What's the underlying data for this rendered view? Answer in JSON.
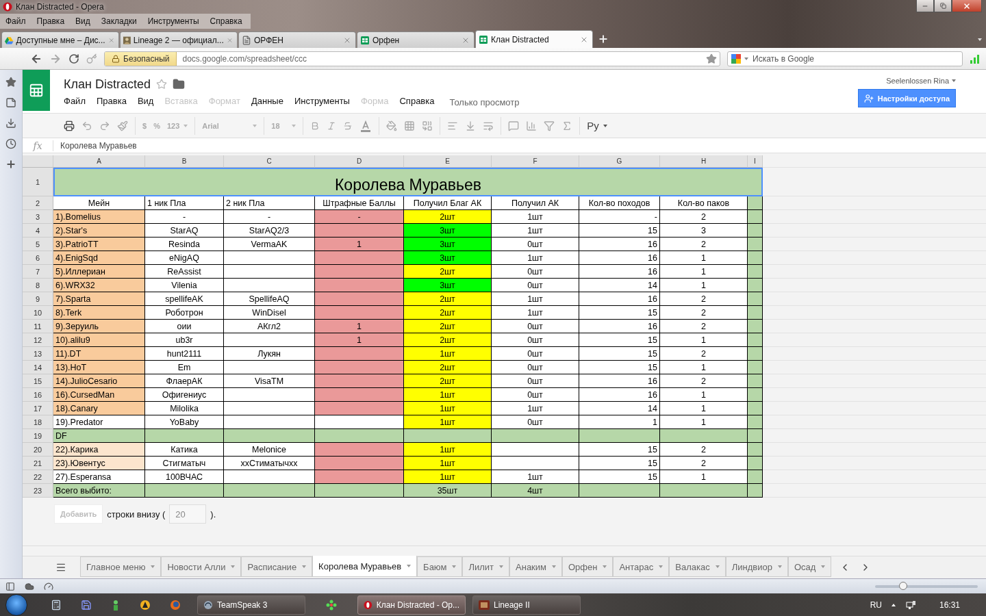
{
  "window": {
    "title": "Клан Distracted - Opera"
  },
  "menu": [
    "Файл",
    "Правка",
    "Вид",
    "Закладки",
    "Инструменты",
    "Справка"
  ],
  "tabs": [
    {
      "title": "Доступные мне – Дис...",
      "selected": false
    },
    {
      "title": "Lineage 2 — официал...",
      "selected": false
    },
    {
      "title": "ОРФЕН",
      "selected": false
    },
    {
      "title": "Орфен",
      "selected": false
    },
    {
      "title": "Клан Distracted",
      "selected": true
    }
  ],
  "address_bar": {
    "security": "Безопасный",
    "url": "docs.google.com/spreadsheet/ccc"
  },
  "search": {
    "placeholder": "Искать в Google"
  },
  "document": {
    "title": "Клан Distracted",
    "starred": false,
    "view_mode": "Только просмотр",
    "account": "Seelenlossen Rina",
    "share_button": "Настройки доступа",
    "menu": [
      {
        "label": "Файл",
        "disabled": false
      },
      {
        "label": "Правка",
        "disabled": false
      },
      {
        "label": "Вид",
        "disabled": false
      },
      {
        "label": "Вставка",
        "disabled": true
      },
      {
        "label": "Формат",
        "disabled": true
      },
      {
        "label": "Данные",
        "disabled": false
      },
      {
        "label": "Инструменты",
        "disabled": false
      },
      {
        "label": "Форма",
        "disabled": true
      },
      {
        "label": "Справка",
        "disabled": false
      }
    ]
  },
  "toolbar": {
    "currency": "$",
    "percent": "%",
    "number_format": "123",
    "font": "Arial",
    "font_size": "18",
    "input_tools": "Ру"
  },
  "formula_bar": {
    "label": "fx",
    "value": "Королева Муравьев"
  },
  "sheet": {
    "columns": [
      "A",
      "B",
      "C",
      "D",
      "E",
      "F",
      "G",
      "H",
      "I"
    ],
    "title_row": {
      "number": "1",
      "text": "Королева Муравьев",
      "color": "#b6d7a8"
    },
    "rows": [
      {
        "number": "2",
        "kind": "header",
        "cells": [
          {
            "text": "Мейн"
          },
          {
            "text": "1 ник Пла"
          },
          {
            "text": "2 ник Пла"
          },
          {
            "text": "Штрафные Баллы"
          },
          {
            "text": "Получил Благ АК"
          },
          {
            "text": "Получил АК"
          },
          {
            "text": "Кол-во походов"
          },
          {
            "text": "Кол-во паков"
          },
          {
            "color": "#b6d7a8"
          }
        ]
      },
      {
        "number": "3",
        "kind": "data",
        "cells": [
          {
            "text": "1).Bomelius",
            "color": "#f9cb9c"
          },
          {
            "text": "-"
          },
          {
            "text": "-"
          },
          {
            "text": "-",
            "color": "#ea9999"
          },
          {
            "text": "2шт",
            "color": "#ffff00"
          },
          {
            "text": "1шт"
          },
          {
            "text": "-"
          },
          {
            "text": "2"
          },
          {
            "color": "#b6d7a8"
          }
        ]
      },
      {
        "number": "4",
        "kind": "data",
        "cells": [
          {
            "text": "2).Star's",
            "color": "#f9cb9c"
          },
          {
            "text": "StarAQ"
          },
          {
            "text": "StarAQ2/3"
          },
          {
            "color": "#ea9999"
          },
          {
            "text": "3шт",
            "color": "#00ff00"
          },
          {
            "text": "1шт"
          },
          {
            "text": "15"
          },
          {
            "text": "3"
          },
          {
            "color": "#b6d7a8"
          }
        ]
      },
      {
        "number": "5",
        "kind": "data",
        "cells": [
          {
            "text": "3).PatrioTT",
            "color": "#f9cb9c"
          },
          {
            "text": "Resinda"
          },
          {
            "text": "VermaAK"
          },
          {
            "text": "1",
            "color": "#ea9999"
          },
          {
            "text": "3шт",
            "color": "#00ff00"
          },
          {
            "text": "0шт"
          },
          {
            "text": "16"
          },
          {
            "text": "2"
          },
          {
            "color": "#b6d7a8"
          }
        ]
      },
      {
        "number": "6",
        "kind": "data",
        "cells": [
          {
            "text": "4).EnigSqd",
            "color": "#f9cb9c"
          },
          {
            "text": "eNigAQ"
          },
          {},
          {
            "color": "#ea9999"
          },
          {
            "text": "3шт",
            "color": "#00ff00"
          },
          {
            "text": "1шт"
          },
          {
            "text": "16"
          },
          {
            "text": "1"
          },
          {
            "color": "#b6d7a8"
          }
        ]
      },
      {
        "number": "7",
        "kind": "data",
        "cells": [
          {
            "text": "5).Иллериан",
            "color": "#f9cb9c"
          },
          {
            "text": "ReAssist"
          },
          {},
          {
            "color": "#ea9999"
          },
          {
            "text": "2шт",
            "color": "#ffff00"
          },
          {
            "text": "0шт"
          },
          {
            "text": "16"
          },
          {
            "text": "1"
          },
          {
            "color": "#b6d7a8"
          }
        ]
      },
      {
        "number": "8",
        "kind": "data",
        "cells": [
          {
            "text": "6).WRX32",
            "color": "#f9cb9c"
          },
          {
            "text": "Vilenia"
          },
          {},
          {
            "color": "#ea9999"
          },
          {
            "text": "3шт",
            "color": "#00ff00"
          },
          {
            "text": "0шт"
          },
          {
            "text": "14"
          },
          {
            "text": "1"
          },
          {
            "color": "#b6d7a8"
          }
        ]
      },
      {
        "number": "9",
        "kind": "data",
        "cells": [
          {
            "text": "7).Sparta",
            "color": "#f9cb9c"
          },
          {
            "text": "spellifeAK"
          },
          {
            "text": "SpellifeAQ"
          },
          {
            "color": "#ea9999"
          },
          {
            "text": "2шт",
            "color": "#ffff00"
          },
          {
            "text": "1шт"
          },
          {
            "text": "16"
          },
          {
            "text": "2"
          },
          {
            "color": "#b6d7a8"
          }
        ]
      },
      {
        "number": "10",
        "kind": "data",
        "cells": [
          {
            "text": "8).Terk",
            "color": "#f9cb9c"
          },
          {
            "text": "Роботрон"
          },
          {
            "text": "WinDisel"
          },
          {
            "color": "#ea9999"
          },
          {
            "text": "2шт",
            "color": "#ffff00"
          },
          {
            "text": "1шт"
          },
          {
            "text": "15"
          },
          {
            "text": "2"
          },
          {
            "color": "#b6d7a8"
          }
        ]
      },
      {
        "number": "11",
        "kind": "data",
        "cells": [
          {
            "text": "9).Зеруиль",
            "color": "#f9cb9c"
          },
          {
            "text": "оии"
          },
          {
            "text": "АКгл2"
          },
          {
            "text": "1",
            "color": "#ea9999"
          },
          {
            "text": "2шт",
            "color": "#ffff00"
          },
          {
            "text": "0шт"
          },
          {
            "text": "16"
          },
          {
            "text": "2"
          },
          {
            "color": "#b6d7a8"
          }
        ]
      },
      {
        "number": "12",
        "kind": "data",
        "cells": [
          {
            "text": "10).alilu9",
            "color": "#f9cb9c"
          },
          {
            "text": "ub3r"
          },
          {},
          {
            "text": "1",
            "color": "#ea9999"
          },
          {
            "text": "2шт",
            "color": "#ffff00"
          },
          {
            "text": "0шт"
          },
          {
            "text": "15"
          },
          {
            "text": "1"
          },
          {
            "color": "#b6d7a8"
          }
        ]
      },
      {
        "number": "13",
        "kind": "data",
        "cells": [
          {
            "text": "11).DT",
            "color": "#f9cb9c"
          },
          {
            "text": "hunt2111"
          },
          {
            "text": "Лукян"
          },
          {
            "color": "#ea9999"
          },
          {
            "text": "1шт",
            "color": "#ffff00"
          },
          {
            "text": "0шт"
          },
          {
            "text": "15"
          },
          {
            "text": "2"
          },
          {
            "color": "#b6d7a8"
          }
        ]
      },
      {
        "number": "14",
        "kind": "data",
        "cells": [
          {
            "text": "13).HoT",
            "color": "#f9cb9c"
          },
          {
            "text": "Em"
          },
          {},
          {
            "color": "#ea9999"
          },
          {
            "text": "2шт",
            "color": "#ffff00"
          },
          {
            "text": "0шт"
          },
          {
            "text": "15"
          },
          {
            "text": "1"
          },
          {
            "color": "#b6d7a8"
          }
        ]
      },
      {
        "number": "15",
        "kind": "data",
        "cells": [
          {
            "text": "14).JulioCesario",
            "color": "#f9cb9c"
          },
          {
            "text": "ФлаерАК"
          },
          {
            "text": "VisaTM"
          },
          {
            "color": "#ea9999"
          },
          {
            "text": "2шт",
            "color": "#ffff00"
          },
          {
            "text": "0шт"
          },
          {
            "text": "16"
          },
          {
            "text": "2"
          },
          {
            "color": "#b6d7a8"
          }
        ]
      },
      {
        "number": "16",
        "kind": "data",
        "cells": [
          {
            "text": "16).CursedMan",
            "color": "#f9cb9c"
          },
          {
            "text": "Офигениус"
          },
          {},
          {
            "color": "#ea9999"
          },
          {
            "text": "1шт",
            "color": "#ffff00"
          },
          {
            "text": "0шт"
          },
          {
            "text": "16"
          },
          {
            "text": "1"
          },
          {
            "color": "#b6d7a8"
          }
        ]
      },
      {
        "number": "17",
        "kind": "data",
        "cells": [
          {
            "text": "18).Canary",
            "color": "#f9cb9c"
          },
          {
            "text": "Milolika"
          },
          {},
          {
            "color": "#ea9999"
          },
          {
            "text": "1шт",
            "color": "#ffff00"
          },
          {
            "text": "1шт"
          },
          {
            "text": "14"
          },
          {
            "text": "1"
          },
          {
            "color": "#b6d7a8"
          }
        ]
      },
      {
        "number": "18",
        "kind": "data",
        "cells": [
          {
            "text": "19).Predator"
          },
          {
            "text": "YoBaby"
          },
          {},
          {},
          {
            "text": "1шт",
            "color": "#ffff00"
          },
          {
            "text": "0шт"
          },
          {
            "text": "1"
          },
          {
            "text": "1"
          },
          {
            "color": "#b6d7a8"
          }
        ]
      },
      {
        "number": "19",
        "kind": "data",
        "cells": [
          {
            "text": "DF",
            "color": "#b6d7a8"
          },
          {
            "color": "#b6d7a8"
          },
          {
            "color": "#b6d7a8"
          },
          {
            "color": "#b6d7a8"
          },
          {
            "color": "#b6d7a8"
          },
          {
            "color": "#b6d7a8"
          },
          {
            "color": "#b6d7a8"
          },
          {
            "color": "#b6d7a8"
          },
          {
            "color": "#b6d7a8"
          }
        ]
      },
      {
        "number": "20",
        "kind": "data",
        "cells": [
          {
            "text": "22).Карика",
            "color": "#fce5cd"
          },
          {
            "text": "Катика"
          },
          {
            "text": "Melonice"
          },
          {
            "color": "#ea9999"
          },
          {
            "text": "1шт",
            "color": "#ffff00"
          },
          {},
          {
            "text": "15"
          },
          {
            "text": "2"
          },
          {
            "color": "#b6d7a8"
          }
        ]
      },
      {
        "number": "21",
        "kind": "data",
        "cells": [
          {
            "text": "23).Ювентус",
            "color": "#fce5cd"
          },
          {
            "text": "Стигматыч"
          },
          {
            "text": "ххСтиматычхх"
          },
          {
            "color": "#ea9999"
          },
          {
            "text": "1шт",
            "color": "#ffff00"
          },
          {},
          {
            "text": "15"
          },
          {
            "text": "2"
          },
          {
            "color": "#b6d7a8"
          }
        ]
      },
      {
        "number": "22",
        "kind": "data",
        "cells": [
          {
            "text": "27).Esperansa"
          },
          {
            "text": "100ВЧАС"
          },
          {},
          {
            "color": "#ea9999"
          },
          {
            "text": "1шт",
            "color": "#ffff00"
          },
          {
            "text": "1шт"
          },
          {
            "text": "15"
          },
          {
            "text": "1"
          },
          {
            "color": "#b6d7a8"
          }
        ]
      },
      {
        "number": "23",
        "kind": "data",
        "cells": [
          {
            "text": "Всего выбито:",
            "color": "#b6d7a8"
          },
          {
            "color": "#b6d7a8"
          },
          {
            "color": "#b6d7a8"
          },
          {
            "color": "#b6d7a8"
          },
          {
            "text": "35шт",
            "color": "#b6d7a8"
          },
          {
            "text": "4шт",
            "color": "#b6d7a8"
          },
          {
            "color": "#b6d7a8"
          },
          {
            "color": "#b6d7a8"
          },
          {
            "color": "#b6d7a8"
          }
        ]
      }
    ]
  },
  "add_rows": {
    "button": "Добавить",
    "label": "строки внизу (",
    "value": "20",
    "suffix": ")."
  },
  "sheet_tabs": [
    {
      "label": "Главное меню",
      "selected": false
    },
    {
      "label": "Новости Алли",
      "selected": false
    },
    {
      "label": "Расписание",
      "selected": false
    },
    {
      "label": "Королева Муравьев",
      "selected": true
    },
    {
      "label": "Баюм",
      "selected": false
    },
    {
      "label": "Лилит",
      "selected": false
    },
    {
      "label": "Анаким",
      "selected": false
    },
    {
      "label": "Орфен",
      "selected": false
    },
    {
      "label": "Антарас",
      "selected": false
    },
    {
      "label": "Валакас",
      "selected": false
    },
    {
      "label": "Линдвиор",
      "selected": false
    },
    {
      "label": "Осад",
      "selected": false
    }
  ],
  "zoom": {
    "level": 0.27
  },
  "taskbar": {
    "items": [
      {
        "label": "TeamSpeak 3",
        "selected": false
      },
      {
        "label": "Клан Distracted - Op...",
        "selected": true
      },
      {
        "label": "Lineage II",
        "selected": false
      }
    ],
    "language": "RU",
    "time": "16:31"
  }
}
